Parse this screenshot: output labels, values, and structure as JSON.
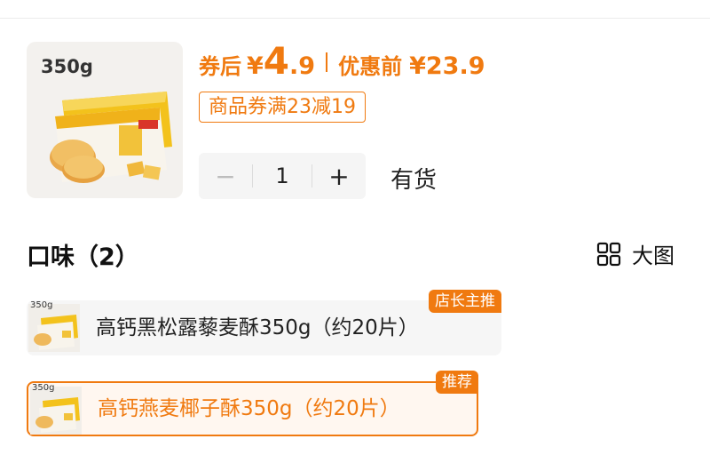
{
  "product": {
    "weight_badge": "350g",
    "price_after_label": "券后",
    "currency": "¥",
    "price_after_int": "4",
    "price_after_dec": ".9",
    "price_before_label": "优惠前",
    "price_before": "¥23.9",
    "coupon_text": "商品券满23减19",
    "quantity": "1",
    "minus_symbol": "−",
    "plus_symbol": "+",
    "stock_status": "有货"
  },
  "flavors": {
    "title": "口味（2）",
    "view_toggle_label": "大图",
    "items": [
      {
        "label": "高钙黑松露藜麦酥350g（约20片）",
        "tag": "店长主推",
        "thumb_weight": "350g",
        "selected": false
      },
      {
        "label": "高钙燕麦椰子酥350g（约20片）",
        "tag": "推荐",
        "thumb_weight": "350g",
        "selected": true
      }
    ]
  },
  "colors": {
    "accent": "#f07a10",
    "option_bg": "#f6f6f6",
    "stepper_bg": "#f5f5f5"
  }
}
